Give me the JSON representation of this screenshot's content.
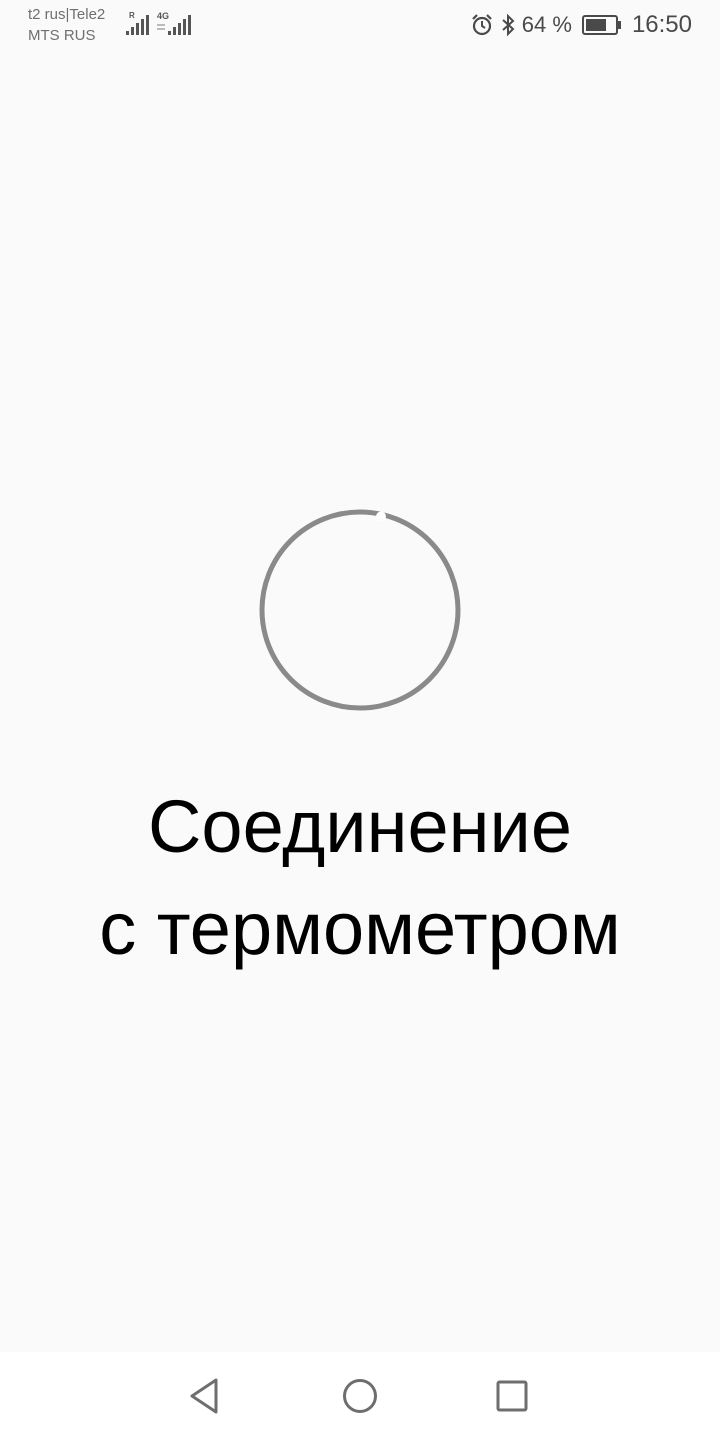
{
  "status_bar": {
    "carrier_1": "t2 rus|Tele2",
    "carrier_2": "MTS RUS",
    "signal_1_badge": "R",
    "signal_2_badge": "4G",
    "battery_percent": "64 %",
    "time": "16:50",
    "icons": [
      "signal-icon",
      "alarm-icon",
      "bluetooth-icon",
      "battery-icon"
    ]
  },
  "main": {
    "message_line_1": "Соединение",
    "message_line_2": "с термометром"
  },
  "colors": {
    "background": "#fafafa",
    "spinner": "#8a8a8a",
    "text": "#000000",
    "status_text": "#4a4a4a",
    "nav_icon": "#6e6e6e"
  },
  "nav_bar": {
    "icons": [
      "back-icon",
      "home-icon",
      "recents-icon"
    ]
  }
}
